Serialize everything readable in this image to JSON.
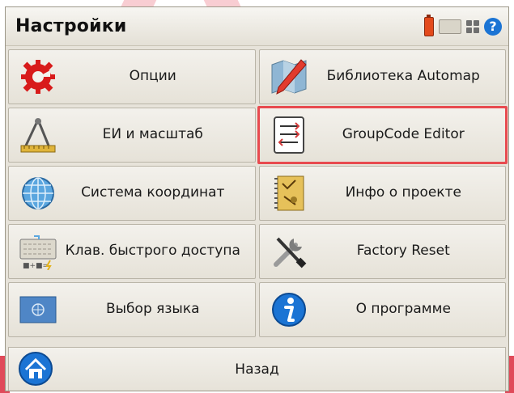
{
  "window": {
    "title": "Настройки"
  },
  "status_icons": [
    "battery-icon",
    "keyboard-icon",
    "grid-icon",
    "help-icon"
  ],
  "tiles": [
    {
      "label": "Опции",
      "icon": "options-gear-icon"
    },
    {
      "label": "Библиотека Automap",
      "icon": "map-library-icon"
    },
    {
      "label": "ЕИ и масштаб",
      "icon": "units-scale-icon"
    },
    {
      "label": "GroupCode Editor",
      "icon": "groupcode-editor-icon"
    },
    {
      "label": "Система координат",
      "icon": "globe-icon"
    },
    {
      "label": "Инфо о проекте",
      "icon": "project-info-icon"
    },
    {
      "label": "Клав. быстрого доступа",
      "icon": "shortcut-keyboard-icon"
    },
    {
      "label": "Factory Reset",
      "icon": "tools-icon"
    },
    {
      "label": "Выбор языка",
      "icon": "language-flag-icon"
    },
    {
      "label": "О программе",
      "icon": "info-icon"
    }
  ],
  "back": {
    "label": "Назад",
    "icon": "home-icon"
  },
  "colors": {
    "highlight": "#e84a4f",
    "accent_blue": "#1b74d4"
  }
}
